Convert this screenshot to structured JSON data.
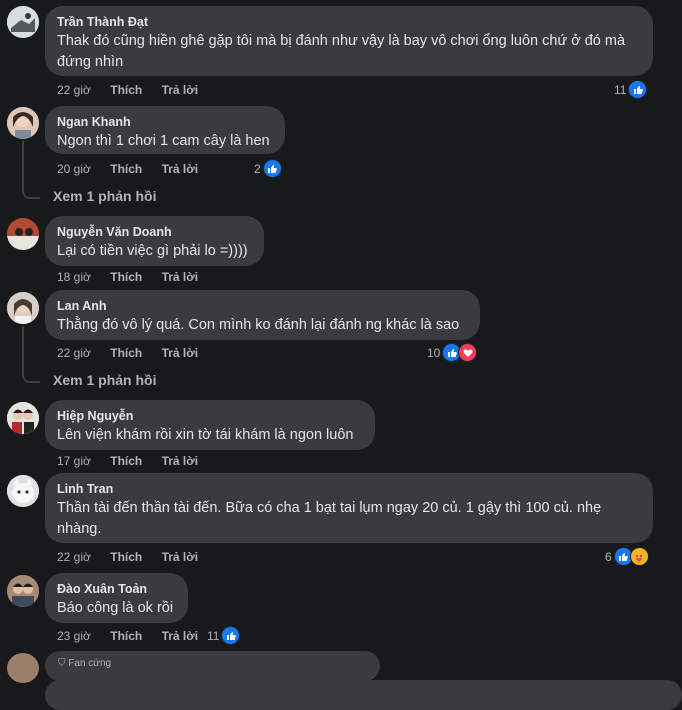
{
  "comments": [
    {
      "name": "Trần Thành Đạt",
      "text": "Thak đó cũng hiền ghê gặp tôi mà bị đánh như vậy là bay vô chơi ổng luôn chứ ở đó mà đứng nhìn",
      "time": "22 giờ",
      "like": "Thích",
      "reply": "Trả lời",
      "reactions": "11",
      "avatar": "trbike-avatar"
    },
    {
      "name": "Ngan Khanh",
      "text": "Ngon thì 1 chơi 1 cam cây là hen",
      "time": "20 giờ",
      "like": "Thích",
      "reply": "Trả lời",
      "reactions": "2",
      "replies_link": "Xem 1 phản hồi"
    },
    {
      "name": "Nguyễn Văn Doanh",
      "text": "Lại có tiền việc gì phải lo =))))",
      "time": "18 giờ",
      "like": "Thích",
      "reply": "Trả lời",
      "reactions": ""
    },
    {
      "name": "Lan Anh",
      "text": "Thằng đó vô lý quá. Con mình ko đánh lại đánh ng khác là sao",
      "time": "22 giờ",
      "like": "Thích",
      "reply": "Trả lời",
      "reactions": "10",
      "replies_link": "Xem 1 phản hồi"
    },
    {
      "name": "Hiệp Nguyễn",
      "text": "Lên viện khám rồi xin tờ tái khám là ngon luôn",
      "time": "17 giờ",
      "like": "Thích",
      "reply": "Trả lời",
      "reactions": ""
    },
    {
      "name": "Linh Tran",
      "text": "Thần tài đến thần tài đến. Bữa có cha 1 bạt tai lụm ngay 20 củ. 1 gậy thì 100 củ. nhẹ nhàng.",
      "time": "22 giờ",
      "like": "Thích",
      "reply": "Trả lời",
      "reactions": "6"
    },
    {
      "name": "Đào Xuân Toản",
      "text": "Báo công là ok rồi",
      "time": "23 giờ",
      "like": "Thích",
      "reply": "Trả lời",
      "reactions": "11"
    }
  ],
  "partial_label": "Fan cứng",
  "colors": {
    "like": "#1877f2",
    "love": "#f33e58",
    "care": "#f7b125",
    "bubble": "#3a3b3c",
    "bg": "#18191a"
  }
}
